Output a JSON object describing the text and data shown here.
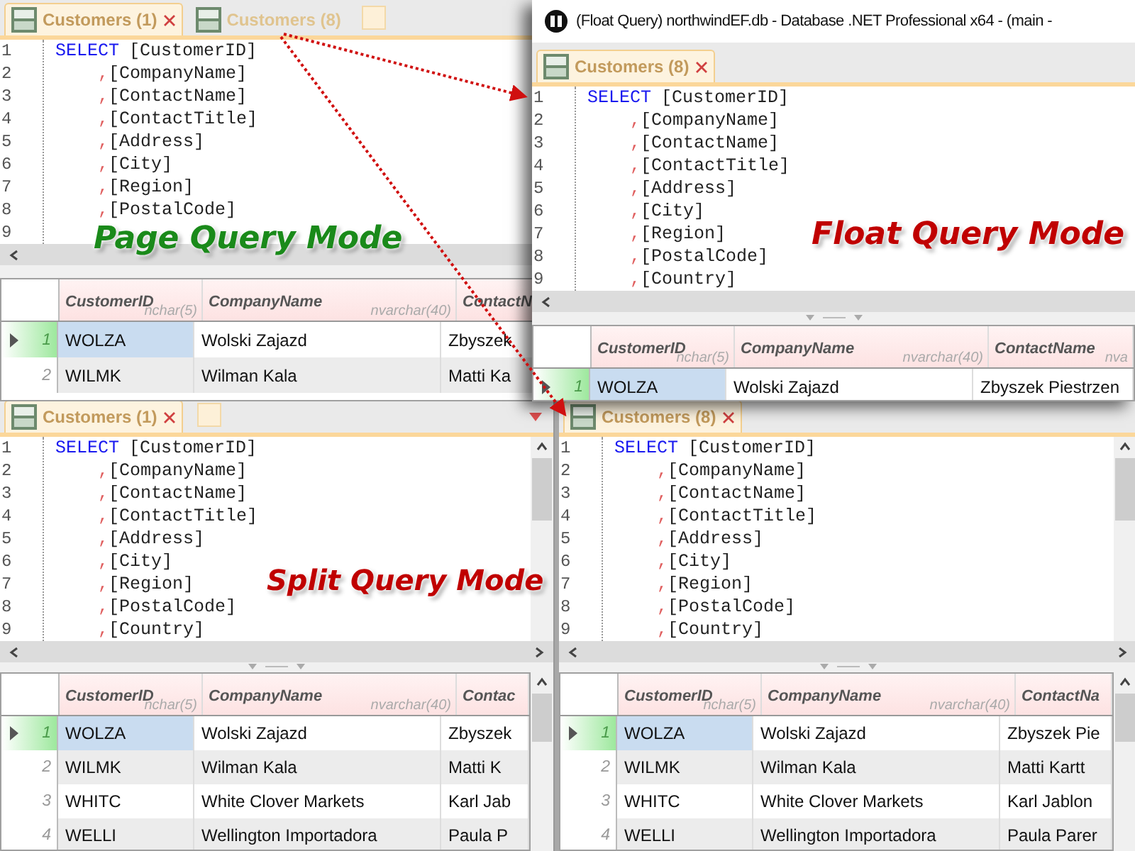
{
  "panels": [
    {
      "kind": "page",
      "tabs": [
        {
          "label": "Customers (1)",
          "selected": true,
          "closable": true
        },
        {
          "label": "Customers (8)",
          "selected": false,
          "closable": false
        }
      ],
      "new_tab": true,
      "menu_arrow": false,
      "editor": {
        "lines": [
          {
            "kind": "keyword",
            "keyword": "SELECT",
            "text": "[CustomerID]"
          },
          {
            "kind": "column",
            "prefix": ",",
            "text": "[CompanyName]"
          },
          {
            "kind": "column",
            "prefix": ",",
            "text": "[ContactName]"
          },
          {
            "kind": "column",
            "prefix": ",",
            "text": "[ContactTitle]"
          },
          {
            "kind": "column",
            "prefix": ",",
            "text": "[Address]"
          },
          {
            "kind": "column",
            "prefix": ",",
            "text": "[City]"
          },
          {
            "kind": "column",
            "prefix": ",",
            "text": "[Region]"
          },
          {
            "kind": "column",
            "prefix": ",",
            "text": "[PostalCode]"
          }
        ],
        "line_numbers": [
          "1",
          "2",
          "3",
          "4",
          "5",
          "6",
          "7",
          "8",
          "9"
        ]
      },
      "grid": {
        "columns": [
          {
            "name": "CustomerID",
            "type": "nchar(5)"
          },
          {
            "name": "CompanyName",
            "type": "nvarchar(40)"
          },
          {
            "name": "ContactN"
          }
        ],
        "rows": [
          {
            "number": "1",
            "selected": true,
            "cells": [
              "WOLZA",
              "Wolski Zajazd",
              "Zbyszek"
            ]
          },
          {
            "number": "2",
            "selected": false,
            "cells": [
              "WILMK",
              "Wilman Kala",
              "Matti Ka"
            ]
          }
        ]
      }
    },
    {
      "kind": "float",
      "title": "(Float Query) northwindEF.db - Database .NET Professional x64 - (main -",
      "tabs": [
        {
          "label": "Customers (8)",
          "selected": true,
          "closable": true
        }
      ],
      "new_tab": false,
      "menu_arrow": false,
      "editor": {
        "lines": [
          {
            "kind": "keyword",
            "keyword": "SELECT",
            "text": "[CustomerID]"
          },
          {
            "kind": "column",
            "prefix": ",",
            "text": "[CompanyName]"
          },
          {
            "kind": "column",
            "prefix": ",",
            "text": "[ContactName]"
          },
          {
            "kind": "column",
            "prefix": ",",
            "text": "[ContactTitle]"
          },
          {
            "kind": "column",
            "prefix": ",",
            "text": "[Address]"
          },
          {
            "kind": "column",
            "prefix": ",",
            "text": "[City]"
          },
          {
            "kind": "column",
            "prefix": ",",
            "text": "[Region]"
          },
          {
            "kind": "column",
            "prefix": ",",
            "text": "[PostalCode]"
          },
          {
            "kind": "column",
            "prefix": ",",
            "text": "[Country]"
          }
        ],
        "line_numbers": [
          "1",
          "2",
          "3",
          "4",
          "5",
          "6",
          "7",
          "8",
          "9"
        ]
      },
      "grid": {
        "columns": [
          {
            "name": "CustomerID",
            "type": "nchar(5)"
          },
          {
            "name": "CompanyName",
            "type": "nvarchar(40)"
          },
          {
            "name": "ContactName",
            "type": "nva"
          }
        ],
        "rows": [
          {
            "number": "1",
            "selected": true,
            "cells": [
              "WOLZA",
              "Wolski Zajazd",
              "Zbyszek Piestrzen"
            ]
          }
        ]
      }
    },
    {
      "kind": "split",
      "tabs": [
        {
          "label": "Customers (1)",
          "selected": true,
          "closable": true
        }
      ],
      "new_tab": true,
      "menu_arrow": true,
      "editor": {
        "lines": [
          {
            "kind": "keyword",
            "keyword": "SELECT",
            "text": "[CustomerID]"
          },
          {
            "kind": "column",
            "prefix": ",",
            "text": "[CompanyName]"
          },
          {
            "kind": "column",
            "prefix": ",",
            "text": "[ContactName]"
          },
          {
            "kind": "column",
            "prefix": ",",
            "text": "[ContactTitle]"
          },
          {
            "kind": "column",
            "prefix": ",",
            "text": "[Address]"
          },
          {
            "kind": "column",
            "prefix": ",",
            "text": "[City]"
          },
          {
            "kind": "column",
            "prefix": ",",
            "text": "[Region]"
          },
          {
            "kind": "column",
            "prefix": ",",
            "text": "[PostalCode]"
          },
          {
            "kind": "column",
            "prefix": ",",
            "text": "[Country]"
          }
        ],
        "line_numbers": [
          "1",
          "2",
          "3",
          "4",
          "5",
          "6",
          "7",
          "8",
          "9"
        ]
      },
      "grid": {
        "columns": [
          {
            "name": "CustomerID",
            "type": "nchar(5)"
          },
          {
            "name": "CompanyName",
            "type": "nvarchar(40)"
          },
          {
            "name": "Contac"
          }
        ],
        "rows": [
          {
            "number": "1",
            "selected": true,
            "cells": [
              "WOLZA",
              "Wolski Zajazd",
              "Zbyszek"
            ]
          },
          {
            "number": "2",
            "selected": false,
            "cells": [
              "WILMK",
              "Wilman Kala",
              "Matti K"
            ]
          },
          {
            "number": "3",
            "selected": false,
            "cells": [
              "WHITC",
              "White Clover Markets",
              "Karl Jab"
            ]
          },
          {
            "number": "4",
            "selected": false,
            "cells": [
              "WELLI",
              "Wellington Importadora",
              "Paula P"
            ]
          }
        ]
      }
    },
    {
      "kind": "split",
      "tabs": [
        {
          "label": "Customers (8)",
          "selected": true,
          "closable": true
        }
      ],
      "new_tab": false,
      "menu_arrow": false,
      "editor": {
        "lines": [
          {
            "kind": "keyword",
            "keyword": "SELECT",
            "text": "[CustomerID]"
          },
          {
            "kind": "column",
            "prefix": ",",
            "text": "[CompanyName]"
          },
          {
            "kind": "column",
            "prefix": ",",
            "text": "[ContactName]"
          },
          {
            "kind": "column",
            "prefix": ",",
            "text": "[ContactTitle]"
          },
          {
            "kind": "column",
            "prefix": ",",
            "text": "[Address]"
          },
          {
            "kind": "column",
            "prefix": ",",
            "text": "[City]"
          },
          {
            "kind": "column",
            "prefix": ",",
            "text": "[Region]"
          },
          {
            "kind": "column",
            "prefix": ",",
            "text": "[PostalCode]"
          },
          {
            "kind": "column",
            "prefix": ",",
            "text": "[Country]"
          }
        ],
        "line_numbers": [
          "1",
          "2",
          "3",
          "4",
          "5",
          "6",
          "7",
          "8",
          "9"
        ]
      },
      "grid": {
        "columns": [
          {
            "name": "CustomerID",
            "type": "nchar(5)"
          },
          {
            "name": "CompanyName",
            "type": "nvarchar(40)"
          },
          {
            "name": "ContactNa"
          }
        ],
        "rows": [
          {
            "number": "1",
            "selected": true,
            "cells": [
              "WOLZA",
              "Wolski Zajazd",
              "Zbyszek Pie"
            ]
          },
          {
            "number": "2",
            "selected": false,
            "cells": [
              "WILMK",
              "Wilman Kala",
              "Matti Kartt"
            ]
          },
          {
            "number": "3",
            "selected": false,
            "cells": [
              "WHITC",
              "White Clover Markets",
              "Karl Jablon"
            ]
          },
          {
            "number": "4",
            "selected": false,
            "cells": [
              "WELLI",
              "Wellington Importadora",
              "Paula Parer"
            ]
          }
        ]
      }
    }
  ],
  "mode_labels": [
    {
      "text": "Page Query Mode",
      "color": "#1a8a1a"
    },
    {
      "text": "Float Query Mode",
      "color": "#c00000"
    },
    {
      "text": "Split Query Mode",
      "color": "#c00000"
    }
  ]
}
